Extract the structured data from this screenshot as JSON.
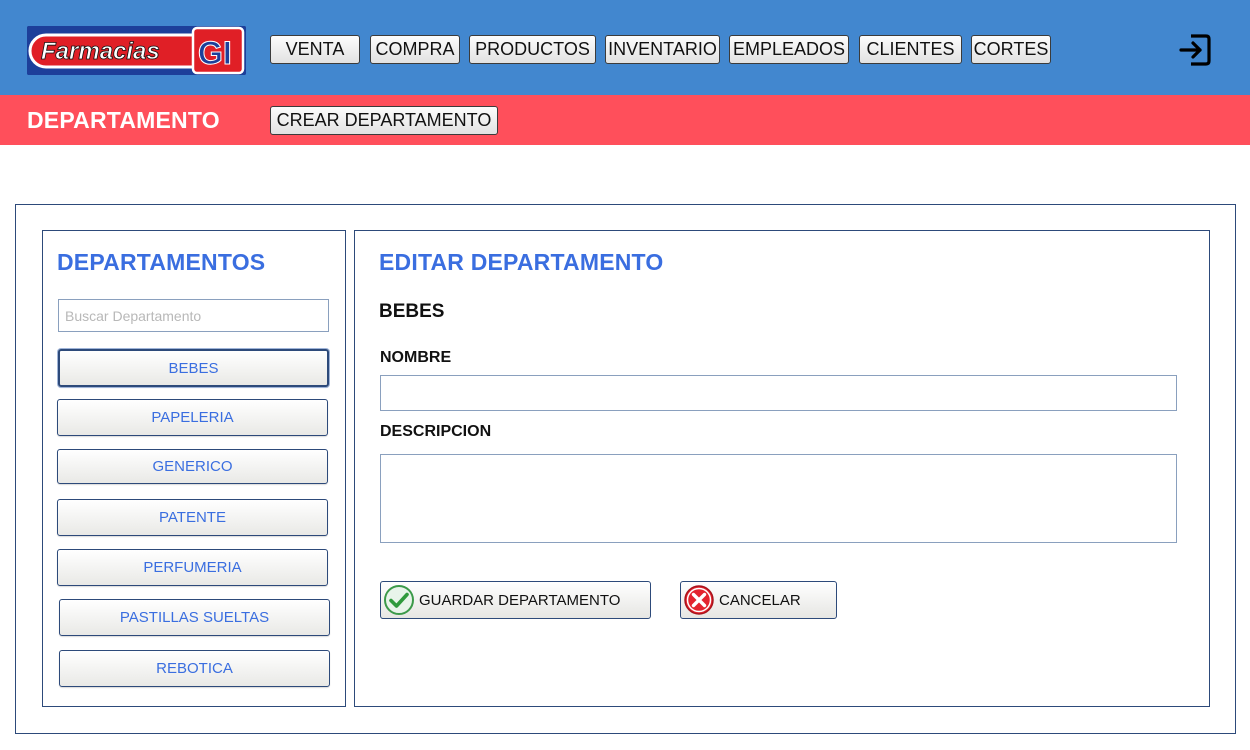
{
  "brand": {
    "logo_text": "Farmacias",
    "logo_mark": "GI"
  },
  "nav": {
    "items": [
      {
        "label": "VENTA"
      },
      {
        "label": "COMPRA"
      },
      {
        "label": "PRODUCTOS"
      },
      {
        "label": "INVENTARIO"
      },
      {
        "label": "EMPLEADOS"
      },
      {
        "label": "CLIENTES"
      },
      {
        "label": "CORTES"
      }
    ],
    "logout_icon": "logout-icon"
  },
  "subbar": {
    "title": "DEPARTAMENTO",
    "create_label": "CREAR DEPARTAMENTO"
  },
  "departments": {
    "title": "DEPARTAMENTOS",
    "search_placeholder": "Buscar Departamento",
    "search_value": "",
    "selected": "BEBES",
    "items": [
      {
        "label": "BEBES"
      },
      {
        "label": "PAPELERIA"
      },
      {
        "label": "GENERICO"
      },
      {
        "label": "PATENTE"
      },
      {
        "label": "PERFUMERIA"
      },
      {
        "label": "PASTILLAS SUELTAS"
      },
      {
        "label": "REBOTICA"
      }
    ]
  },
  "editor": {
    "title": "EDITAR DEPARTAMENTO",
    "selected_name": "BEBES",
    "name_label": "NOMBRE",
    "name_value": "",
    "description_label": "DESCRIPCION",
    "description_value": "",
    "save_label": "GUARDAR DEPARTAMENTO",
    "save_icon": "check-icon",
    "cancel_label": "CANCELAR",
    "cancel_icon": "x-circle-icon"
  },
  "colors": {
    "topbar": "#4287cf",
    "subbar": "#ff4f5b",
    "accent_text": "#3a6ee0",
    "border": "#2d4a7a",
    "logo_bg": "#1d3f9a",
    "logo_red": "#e01f26"
  }
}
